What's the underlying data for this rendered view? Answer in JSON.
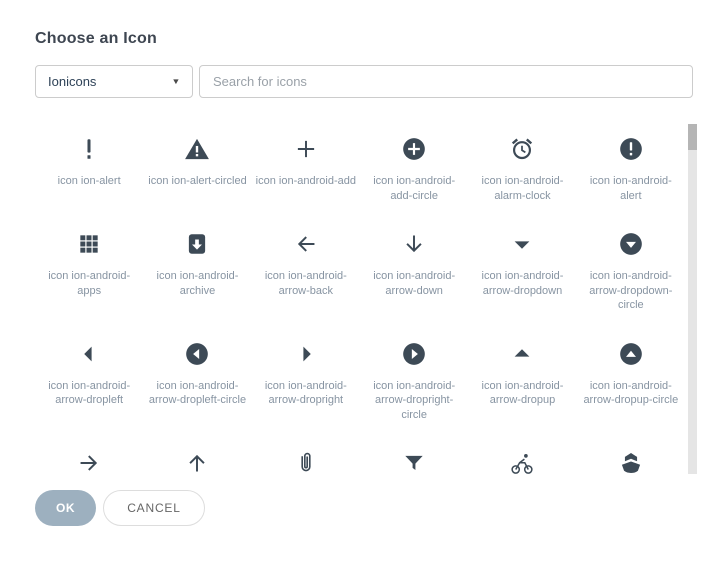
{
  "dialog": {
    "title": "Choose an Icon",
    "icon_set_select": {
      "value": "Ionicons"
    },
    "search": {
      "placeholder": "Search for icons"
    },
    "buttons": {
      "ok": "OK",
      "cancel": "CANCEL"
    }
  },
  "colors": {
    "icon": "#3d4a56",
    "label_text": "#8794a2",
    "title_text": "#3e4651",
    "ok_button_bg": "#9db0bf"
  },
  "icon_grid": {
    "items": [
      {
        "label": "icon ion-alert",
        "icon": "alert"
      },
      {
        "label": "icon ion-alert-circled",
        "icon": "alert-circled"
      },
      {
        "label": "icon ion-android-add",
        "icon": "android-add"
      },
      {
        "label": "icon ion-android-add-circle",
        "icon": "android-add-circle"
      },
      {
        "label": "icon ion-android-alarm-clock",
        "icon": "android-alarm-clock"
      },
      {
        "label": "icon ion-android-alert",
        "icon": "android-alert"
      },
      {
        "label": "icon ion-android-apps",
        "icon": "android-apps"
      },
      {
        "label": "icon ion-android-archive",
        "icon": "android-archive"
      },
      {
        "label": "icon ion-android-arrow-back",
        "icon": "android-arrow-back"
      },
      {
        "label": "icon ion-android-arrow-down",
        "icon": "android-arrow-down"
      },
      {
        "label": "icon ion-android-arrow-dropdown",
        "icon": "android-arrow-dropdown"
      },
      {
        "label": "icon ion-android-arrow-dropdown-circle",
        "icon": "android-arrow-dropdown-circle"
      },
      {
        "label": "icon ion-android-arrow-dropleft",
        "icon": "android-arrow-dropleft"
      },
      {
        "label": "icon ion-android-arrow-dropleft-circle",
        "icon": "android-arrow-dropleft-circle"
      },
      {
        "label": "icon ion-android-arrow-dropright",
        "icon": "android-arrow-dropright"
      },
      {
        "label": "icon ion-android-arrow-dropright-circle",
        "icon": "android-arrow-dropright-circle"
      },
      {
        "label": "icon ion-android-arrow-dropup",
        "icon": "android-arrow-dropup"
      },
      {
        "label": "icon ion-android-arrow-dropup-circle",
        "icon": "android-arrow-dropup-circle"
      },
      {
        "label": "",
        "icon": "android-arrow-forward"
      },
      {
        "label": "",
        "icon": "android-arrow-up"
      },
      {
        "label": "",
        "icon": "android-attach"
      },
      {
        "label": "",
        "icon": "android-funnel"
      },
      {
        "label": "",
        "icon": "android-bicycle"
      },
      {
        "label": "",
        "icon": "android-boat"
      }
    ]
  }
}
